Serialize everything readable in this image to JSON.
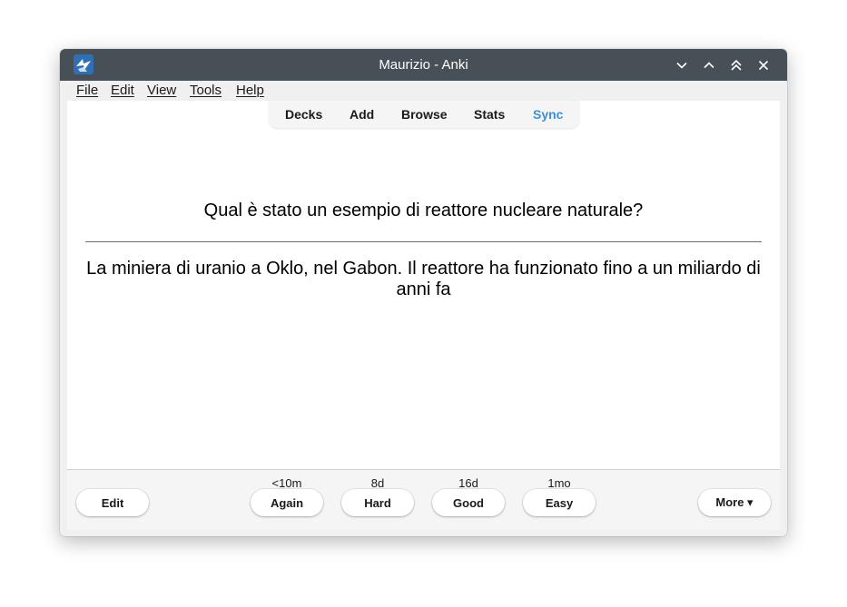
{
  "window": {
    "title": "Maurizio - Anki",
    "accent_color": "#475057"
  },
  "menubar": {
    "items": [
      {
        "label": "File"
      },
      {
        "label": "Edit"
      },
      {
        "label": "View"
      },
      {
        "label": "Tools"
      },
      {
        "label": "Help"
      }
    ]
  },
  "toolbar": {
    "decks": "Decks",
    "add": "Add",
    "browse": "Browse",
    "stats": "Stats",
    "sync": "Sync",
    "sync_color": "#3e8fd9"
  },
  "card": {
    "question": "Qual è stato un esempio di reattore nucleare naturale?",
    "answer": "La miniera di uranio a Oklo, nel Gabon. Il reattore ha funzionato fino a un miliardo di anni fa"
  },
  "bottom": {
    "edit": "Edit",
    "again": {
      "label": "Again",
      "interval": "<10m"
    },
    "hard": {
      "label": "Hard",
      "interval": "8d"
    },
    "good": {
      "label": "Good",
      "interval": "16d"
    },
    "easy": {
      "label": "Easy",
      "interval": "1mo"
    },
    "more": "More ▾"
  }
}
